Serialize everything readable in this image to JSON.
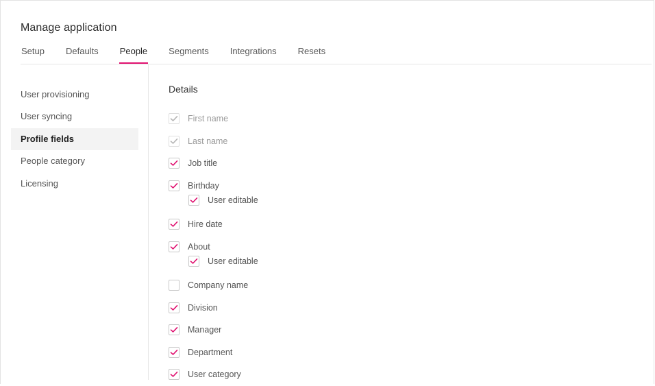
{
  "header": {
    "title": "Manage application"
  },
  "tabs": [
    {
      "label": "Setup",
      "active": false
    },
    {
      "label": "Defaults",
      "active": false
    },
    {
      "label": "People",
      "active": true
    },
    {
      "label": "Segments",
      "active": false
    },
    {
      "label": "Integrations",
      "active": false
    },
    {
      "label": "Resets",
      "active": false
    }
  ],
  "sidebar": {
    "items": [
      {
        "label": "User provisioning",
        "active": false
      },
      {
        "label": "User syncing",
        "active": false
      },
      {
        "label": "Profile fields",
        "active": true
      },
      {
        "label": "People category",
        "active": false
      },
      {
        "label": "Licensing",
        "active": false
      }
    ]
  },
  "details": {
    "title": "Details",
    "fields": [
      {
        "label": "First name",
        "checked": true,
        "disabled": true
      },
      {
        "label": "Last name",
        "checked": true,
        "disabled": true
      },
      {
        "label": "Job title",
        "checked": true,
        "disabled": false
      },
      {
        "label": "Birthday",
        "checked": true,
        "disabled": false
      },
      {
        "label": "User editable",
        "checked": true,
        "disabled": false,
        "sub": true
      },
      {
        "label": "Hire date",
        "checked": true,
        "disabled": false
      },
      {
        "label": "About",
        "checked": true,
        "disabled": false
      },
      {
        "label": "User editable",
        "checked": true,
        "disabled": false,
        "sub": true
      },
      {
        "label": "Company name",
        "checked": false,
        "disabled": false
      },
      {
        "label": "Division",
        "checked": true,
        "disabled": false
      },
      {
        "label": "Manager",
        "checked": true,
        "disabled": false
      },
      {
        "label": "Department",
        "checked": true,
        "disabled": false
      },
      {
        "label": "User category",
        "checked": true,
        "disabled": false
      }
    ]
  },
  "colors": {
    "accent": "#e0106f",
    "disabled_check": "#b5b5b5"
  },
  "icons": {
    "check": "checkmark-icon"
  }
}
